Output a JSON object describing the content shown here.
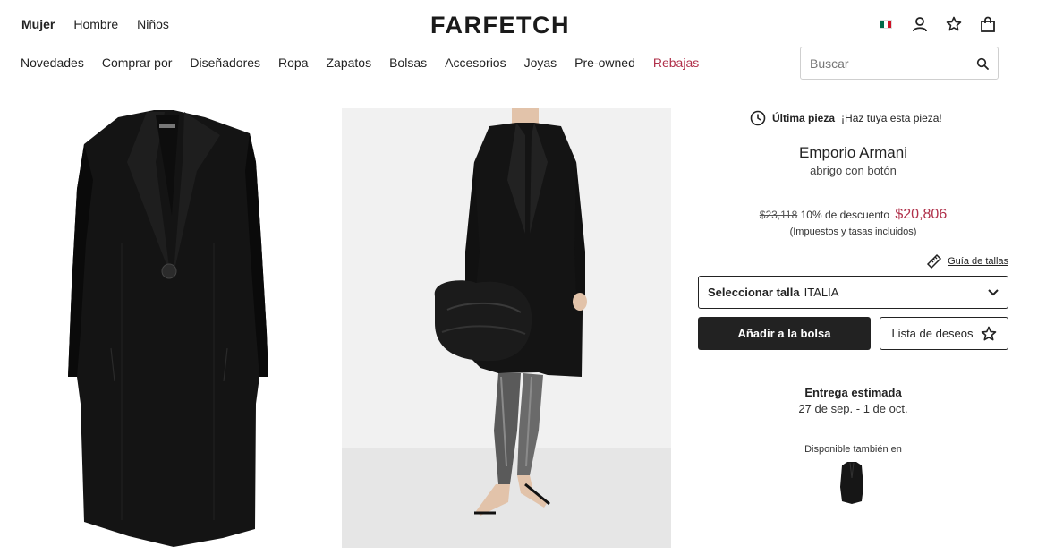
{
  "header": {
    "gender_nav": [
      "Mujer",
      "Hombre",
      "Niños"
    ],
    "logo": "FARFETCH",
    "icons": [
      "mexico-flag-icon",
      "account-icon",
      "wishlist-star-icon",
      "shopping-bag-icon"
    ]
  },
  "main_nav": [
    "Novedades",
    "Comprar por",
    "Diseñadores",
    "Ropa",
    "Zapatos",
    "Bolsas",
    "Accesorios",
    "Joyas",
    "Pre-owned",
    "Rebajas"
  ],
  "search": {
    "placeholder": "Buscar"
  },
  "product": {
    "last_piece_bold": "Última pieza",
    "last_piece_text": "¡Haz tuya esta pieza!",
    "brand": "Emporio Armani",
    "name": "abrigo con botón",
    "old_price": "$23,118",
    "discount": "10% de descuento",
    "new_price": "$20,806",
    "tax_note": "(Impuestos y tasas incluidos)",
    "size_guide": "Guía de tallas",
    "size_label": "Seleccionar talla",
    "size_system": "ITALIA",
    "add_to_bag": "Añadir a la bolsa",
    "wishlist": "Lista de deseos",
    "delivery_title": "Entrega estimada",
    "delivery_dates": "27 de sep. - 1 de oct.",
    "also_available": "Disponible también en"
  },
  "colors": {
    "sale": "#b0304a",
    "button_dark": "#222222",
    "image_bg": "#efefef"
  }
}
